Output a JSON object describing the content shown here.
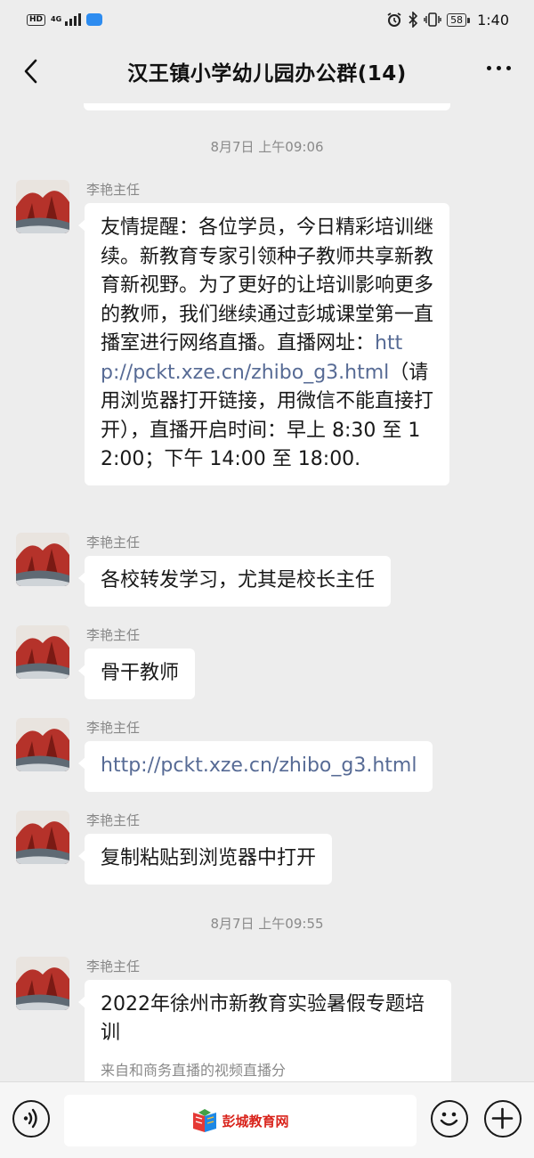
{
  "status_bar": {
    "hd": "HD",
    "network": "4G",
    "battery": "58",
    "time": "1:40"
  },
  "header": {
    "title": "汉王镇小学幼儿园办公群(14)"
  },
  "timestamps": {
    "first": "8月7日 上午09:06",
    "second": "8月7日 上午09:55"
  },
  "messages": [
    {
      "sender": "李艳主任",
      "text_before_link": "友情提醒：各位学员，今日精彩培训继续。新教育专家引领种子教师共享新教育新视野。为了更好的让培训影响更多的教师，我们继续通过彭城课堂第一直播室进行网络直播。直播网址：",
      "link": "http://pckt.xze.cn/zhibo_g3.html",
      "text_after_link": "（请用浏览器打开链接，用微信不能直接打开），直播开启时间：早上 8:30 至 12:00；下午 14:00 至 18:00."
    },
    {
      "sender": "李艳主任",
      "text": "各校转发学习，尤其是校长主任"
    },
    {
      "sender": "李艳主任",
      "text": "骨干教师"
    },
    {
      "sender": "李艳主任",
      "link": "http://pckt.xze.cn/zhibo_g3.html"
    },
    {
      "sender": "李艳主任",
      "text": "复制粘贴到浏览器中打开"
    },
    {
      "sender": "李艳主任",
      "card_title": "2022年徐州市新教育实验暑假专题培训",
      "card_subtitle": "来自和商务直播的视频直播分"
    }
  ],
  "bottom_bar": {
    "watermark": "彭城教育网"
  },
  "icons": {
    "back": "chevron-left-icon",
    "more": "more-dots-icon",
    "voice": "voice-icon",
    "emoji": "emoji-icon",
    "plus": "plus-icon"
  },
  "colors": {
    "background": "#ededed",
    "bubble": "#ffffff",
    "link": "#576b95",
    "timestamp": "#8a8a8a"
  }
}
